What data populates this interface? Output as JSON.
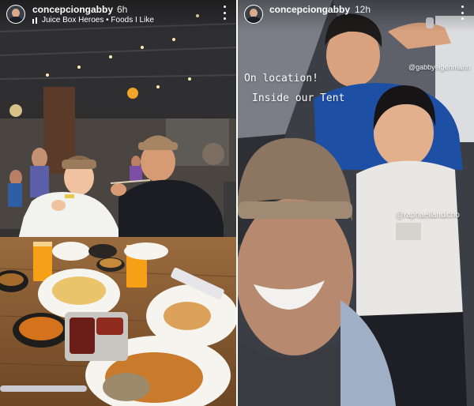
{
  "stories": [
    {
      "username": "concepciongabby",
      "time": "6h",
      "music": "Juice Box Heroes • Foods I Like"
    },
    {
      "username": "concepciongabby",
      "time": "12h",
      "caption_line1": "On location!",
      "caption_line2": "Inside our Tent",
      "tag_top": "@gabbyeigenmann",
      "tag_bottom": "@raphaellandicho"
    }
  ],
  "icons": {
    "menu": "more-vertical-icon",
    "music": "music-icon",
    "avatar": "profile-avatar"
  }
}
